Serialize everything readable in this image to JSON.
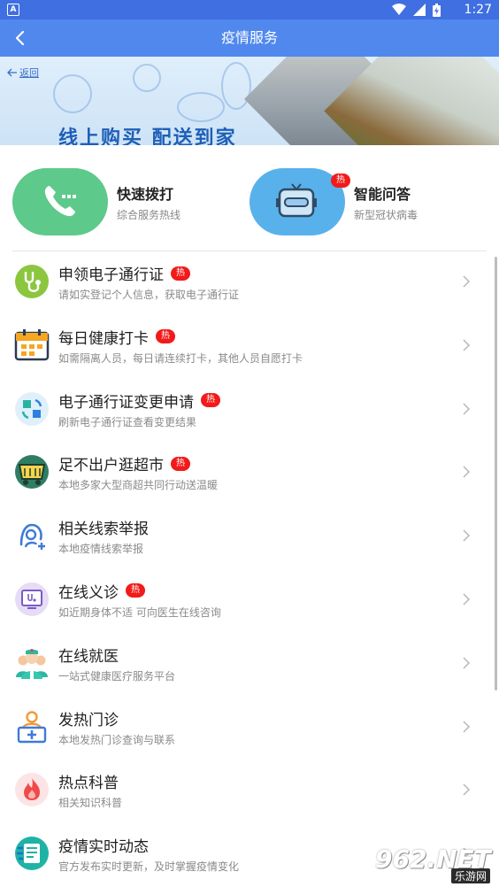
{
  "status_bar": {
    "app_badge": "A",
    "time": "1:27"
  },
  "app_bar": {
    "title": "疫情服务"
  },
  "banner": {
    "back_label": "返回",
    "slogan": "线上购买 配送到家"
  },
  "quick_actions": [
    {
      "name": "快速拨打",
      "sub": "综合服务热线",
      "icon": "phone-icon",
      "bg": "#5dc98a"
    },
    {
      "name": "智能问答",
      "sub": "新型冠状病毒",
      "icon": "robot-icon",
      "bg": "#59b1ec",
      "badge": "热"
    }
  ],
  "services": [
    {
      "title": "申领电子通行证",
      "desc": "请如实登记个人信息，获取电子通行证",
      "hot": "热",
      "icon": "stethoscope-icon"
    },
    {
      "title": "每日健康打卡",
      "desc": "如需隔离人员，每日请连续打卡，其他人员自愿打卡",
      "hot": "热",
      "icon": "calendar-icon"
    },
    {
      "title": "电子通行证变更申请",
      "desc": "刷新电子通行证查看变更结果",
      "hot": "热",
      "icon": "refresh-icon"
    },
    {
      "title": "足不出户逛超市",
      "desc": "本地多家大型商超共同行动送温暖",
      "hot": "热",
      "icon": "cart-icon"
    },
    {
      "title": "相关线索举报",
      "desc": "本地疫情线索举报",
      "hot": "",
      "icon": "report-user-icon"
    },
    {
      "title": "在线义诊",
      "desc": "如近期身体不适 可向医生在线咨询",
      "hot": "热",
      "icon": "monitor-stethoscope-icon"
    },
    {
      "title": "在线就医",
      "desc": "一站式健康医疗服务平台",
      "hot": "",
      "icon": "doctors-icon"
    },
    {
      "title": "发热门诊",
      "desc": "本地发热门诊查询与联系",
      "hot": "",
      "icon": "medical-kit-icon"
    },
    {
      "title": "热点科普",
      "desc": "相关知识科普",
      "hot": "",
      "icon": "flame-icon"
    },
    {
      "title": "疫情实时动态",
      "desc": "官方发布实时更新，及时掌握疫情变化",
      "hot": "",
      "icon": "news-icon"
    }
  ],
  "watermark": {
    "brand": "962.NET",
    "sub": "乐游网"
  }
}
